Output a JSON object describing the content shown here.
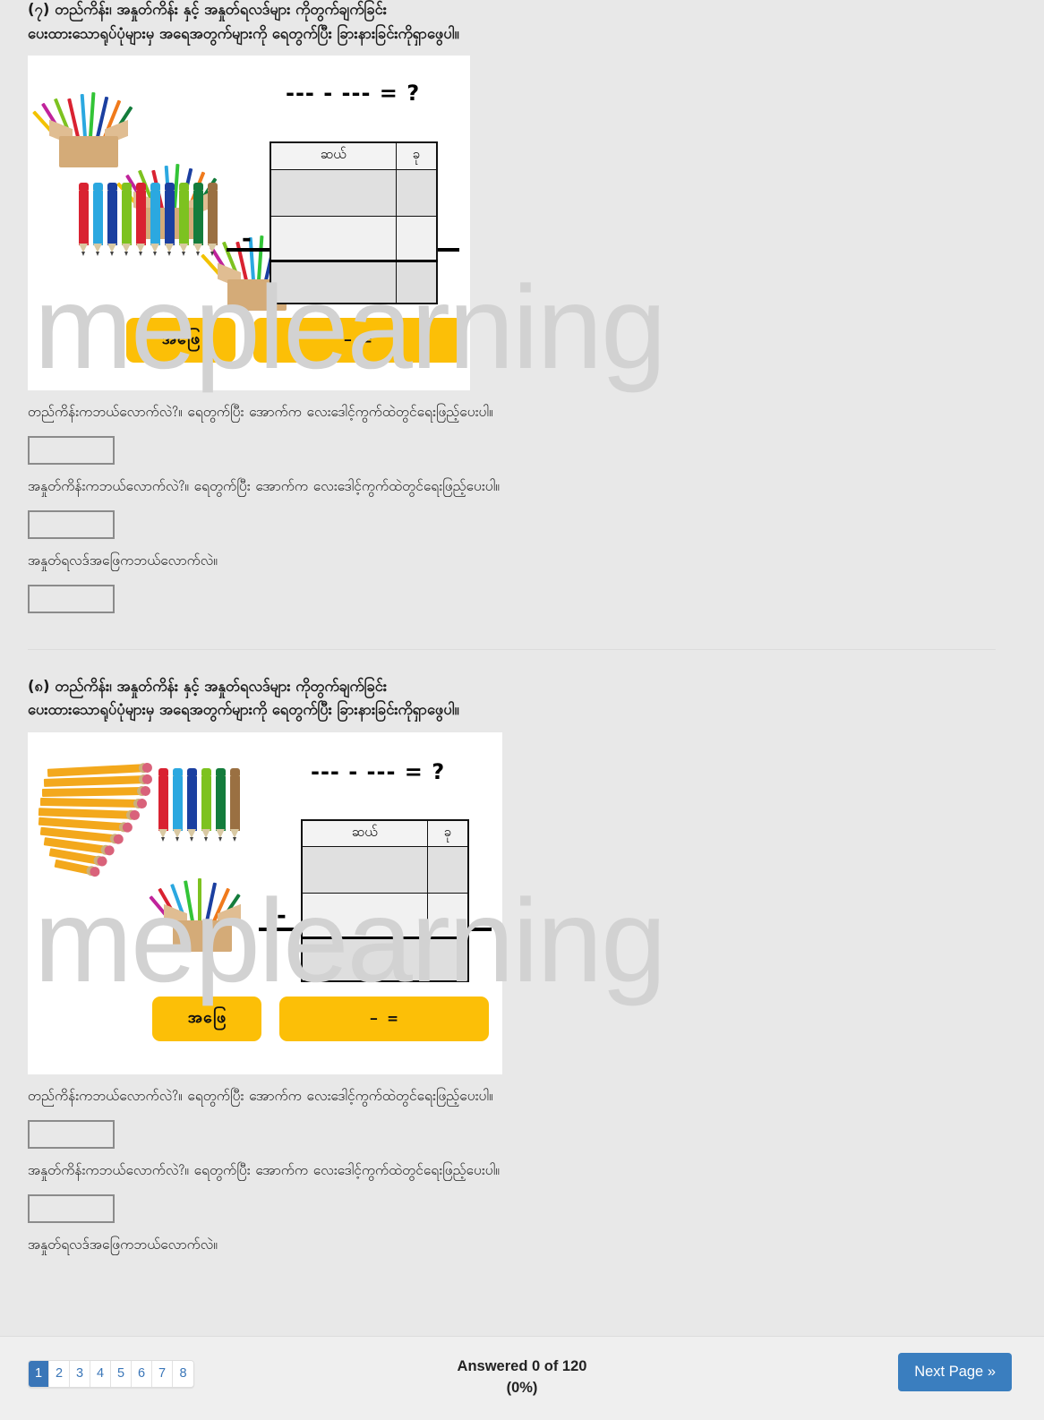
{
  "watermark": {
    "text": "meplearning"
  },
  "questions": [
    {
      "number_label": "(၇)",
      "heading_line1": "(၇) တည်ကိန်း၊ အနှုတ်ကိန်း နှင့် အနှုတ်ရလဒ်များ ကိုတွက်ချက်ခြင်း",
      "heading_line2": "ပေးထားသောရုပ်ပုံများမှ အရေအတွက်များကို ရေတွက်ပြီး ခြားနားခြင်းကိုရှာဖွေပါ။",
      "illustration": {
        "equation": "--- - --- = ?",
        "minus_sign": "-",
        "table": {
          "headers": [
            "ဆယ်",
            "ခု"
          ],
          "rows": [
            [
              "",
              ""
            ],
            [
              "",
              ""
            ],
            [
              "",
              ""
            ]
          ]
        },
        "buttons": [
          {
            "label": "အဖြေ"
          },
          {
            "label": "-   ="
          }
        ],
        "pencil_boxes": 3,
        "loose_pencils": 10,
        "loose_pencil_colors": [
          "#D92231",
          "#2BA8E0",
          "#1B3FA0",
          "#7DC220",
          "#D92231",
          "#2BA8E0",
          "#1B3FA0",
          "#7DC220",
          "#147C3C",
          "#9A7042"
        ]
      },
      "prompts": [
        {
          "text": "တည်ကိန်းကဘယ်လောက်လဲ?။ ရေတွက်ပြီး အောက်က လေးဒေါင့်ကွက်ထဲတွင်ရေးဖြည့်ပေးပါ။",
          "answer": "",
          "placeholder": ""
        },
        {
          "text": "အနှုတ်ကိန်းကဘယ်လောက်လဲ?။ ရေတွက်ပြီး အောက်က လေးဒေါင့်ကွက်ထဲတွင်ရေးဖြည့်ပေးပါ။",
          "answer": "",
          "placeholder": ""
        },
        {
          "text": "အနှုတ်ရလဒ်အဖြေကဘယ်လောက်လဲ။",
          "answer": "",
          "placeholder": ""
        }
      ]
    },
    {
      "number_label": "(၈)",
      "heading_line1": "(၈) တည်ကိန်း၊ အနှုတ်ကိန်း နှင့် အနှုတ်ရလဒ်များ ကိုတွက်ချက်ခြင်း",
      "heading_line2": "ပေးထားသောရုပ်ပုံများမှ အရေအတွက်များကို ရေတွက်ပြီး ခြားနားခြင်းကိုရှာဖွေပါ။",
      "illustration": {
        "equation": "--- - --- = ?",
        "minus_sign": "-",
        "table": {
          "headers": [
            "ဆယ်",
            "ခု"
          ],
          "rows": [
            [
              "",
              ""
            ],
            [
              "",
              ""
            ],
            [
              "",
              ""
            ]
          ]
        },
        "buttons": [
          {
            "label": "အဖြေ"
          },
          {
            "label": "-   ="
          }
        ],
        "pencil_bundle": true,
        "loose_pencils": 6,
        "loose_pencil_colors": [
          "#D92231",
          "#2BA8E0",
          "#1B3FA0",
          "#7DC220",
          "#147C3C",
          "#9A7042"
        ],
        "pencil_boxes": 1
      },
      "prompts": [
        {
          "text": "တည်ကိန်းကဘယ်လောက်လဲ?။ ရေတွက်ပြီး အောက်က လေးဒေါင့်ကွက်ထဲတွင်ရေးဖြည့်ပေးပါ။",
          "answer": "",
          "placeholder": ""
        },
        {
          "text": "အနှုတ်ကိန်းကဘယ်လောက်လဲ?။ ရေတွက်ပြီး အောက်က လေးဒေါင့်ကွက်ထဲတွင်ရေးဖြည့်ပေးပါ။",
          "answer": "",
          "placeholder": ""
        },
        {
          "text": "အနှုတ်ရလဒ်အဖြေကဘယ်လောက်လဲ။",
          "answer": "",
          "placeholder": ""
        }
      ]
    }
  ],
  "footer": {
    "pages": [
      "1",
      "2",
      "3",
      "4",
      "5",
      "6",
      "7",
      "8"
    ],
    "active_page": "1",
    "answered_line1": "Answered 0 of 120",
    "answered_line2": "(0%)",
    "next_label": "Next Page »"
  },
  "colors": {
    "page_bg": "#e8e8e8",
    "accent_blue": "#3a7ebf",
    "button_yellow": "#FCBF07",
    "watermark_gray": "#d2d2d2"
  }
}
